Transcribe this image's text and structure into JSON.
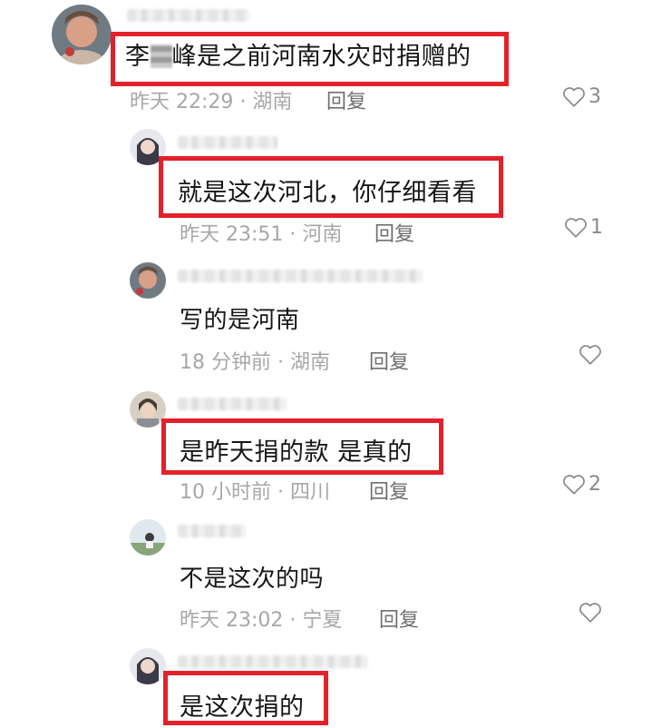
{
  "comments": [
    {
      "text_prefix": "李",
      "text_suffix": "峰是之前河南水灾时捐赠的",
      "meta": "昨天 22:29 · 湖南",
      "reply": "回复",
      "likes": "3"
    },
    {
      "text": "就是这次河北，你仔细看看",
      "meta": "昨天 23:51 · 河南",
      "reply": "回复",
      "likes": "1"
    },
    {
      "text": "写的是河南",
      "meta": "18 分钟前 · 湖南",
      "reply": "回复",
      "likes": ""
    },
    {
      "text": "是昨天捐的款 是真的",
      "meta": "10 小时前 · 四川",
      "reply": "回复",
      "likes": "2"
    },
    {
      "text": "不是这次的吗",
      "meta": "昨天 23:02 · 宁夏",
      "reply": "回复",
      "likes": ""
    },
    {
      "text": "是这次捐的",
      "meta": "",
      "reply": "",
      "likes": ""
    }
  ],
  "colors": {
    "highlight": "#e3212b",
    "meta": "#a7a7a7",
    "reply": "#6f6f6f"
  },
  "icons": {
    "like": "heart-outline-icon"
  }
}
